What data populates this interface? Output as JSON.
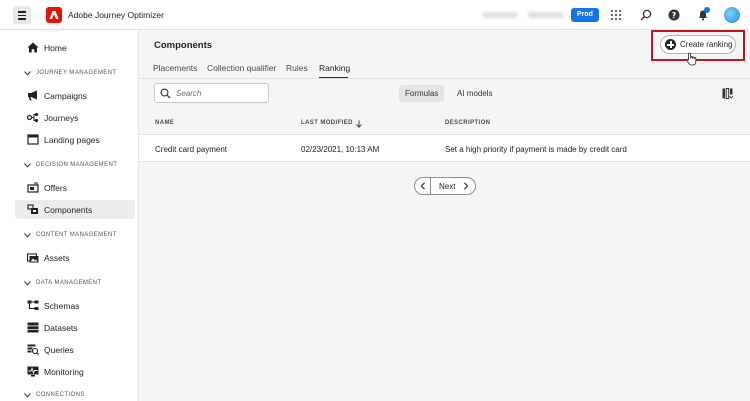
{
  "app": {
    "title": "Adobe Journey Optimizer",
    "sandbox": "Prod"
  },
  "sidebar": {
    "home": "Home",
    "sections": [
      {
        "label": "JOURNEY MANAGEMENT"
      },
      {
        "label": "DECISION MANAGEMENT"
      },
      {
        "label": "CONTENT MANAGEMENT"
      },
      {
        "label": "DATA MANAGEMENT"
      },
      {
        "label": "CONNECTIONS"
      }
    ],
    "items": {
      "campaigns": "Campaigns",
      "journeys": "Journeys",
      "landing_pages": "Landing pages",
      "offers": "Offers",
      "components": "Components",
      "assets": "Assets",
      "schemas": "Schemas",
      "datasets": "Datasets",
      "queries": "Queries",
      "monitoring": "Monitoring"
    }
  },
  "main": {
    "title": "Components",
    "create_button": "Create ranking",
    "tabs": [
      {
        "label": "Placements"
      },
      {
        "label": "Collection qualifier"
      },
      {
        "label": "Rules"
      },
      {
        "label": "Ranking"
      }
    ],
    "search_placeholder": "Search",
    "segments": [
      {
        "label": "Formulas"
      },
      {
        "label": "AI models"
      }
    ],
    "table": {
      "headers": {
        "name": "NAME",
        "modified": "LAST MODIFIED",
        "description": "DESCRIPTION"
      },
      "rows": [
        {
          "name": "Credit card payment",
          "modified": "02/23/2021, 10:13 AM",
          "description": "Set a high priority if payment is made by credit card"
        }
      ]
    },
    "pager": {
      "next": "Next"
    }
  },
  "colors": {
    "brand": "#eb1000",
    "accent": "#1473e6",
    "highlight": "#c0171d"
  }
}
